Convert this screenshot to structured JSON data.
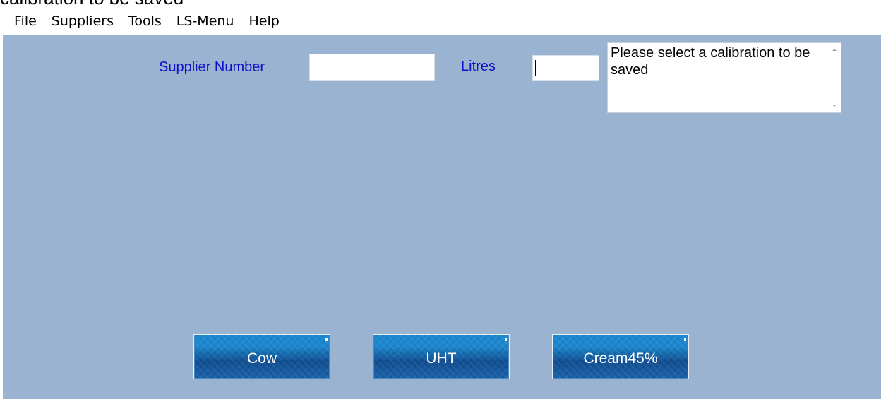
{
  "window": {
    "clipped_title": "calibration to be saved"
  },
  "menu": {
    "items": [
      "File",
      "Suppliers",
      "Tools",
      "LS-Menu",
      "Help"
    ]
  },
  "form": {
    "supplier_label": "Supplier Number",
    "supplier_value": "",
    "litres_label": "Litres",
    "litres_value": ""
  },
  "message": {
    "text": "Please select a calibration to be saved"
  },
  "buttons": {
    "cow": "Cow",
    "uht": "UHT",
    "cream": "Cream45%"
  },
  "colors": {
    "client_background": "#99b3d1",
    "label_text": "#1010c8",
    "button_blue": "#1670b4"
  }
}
